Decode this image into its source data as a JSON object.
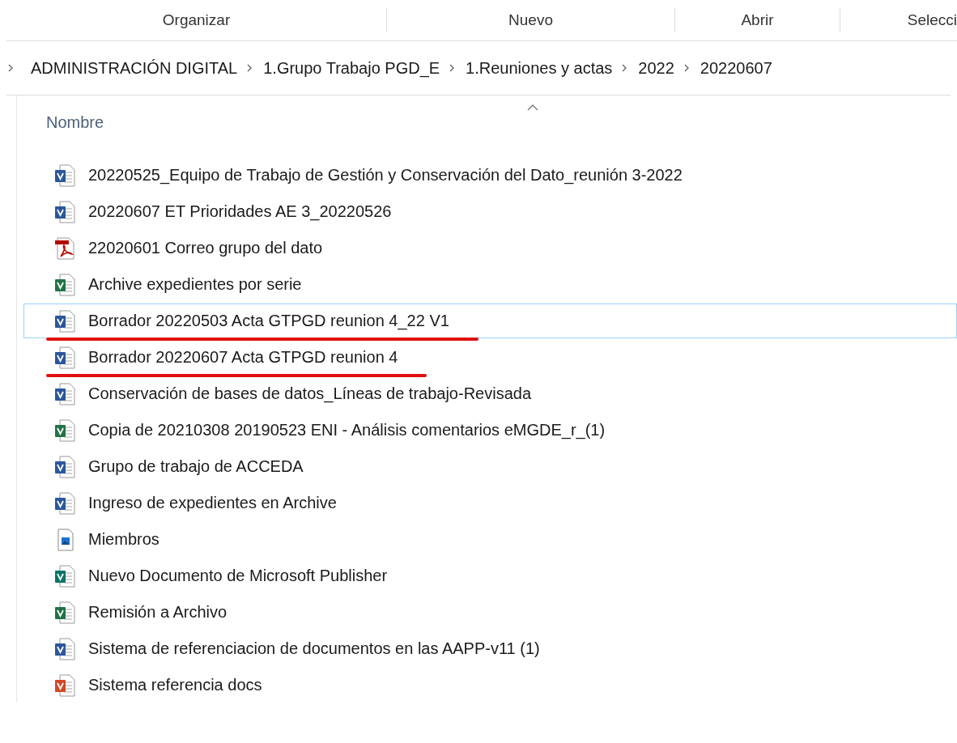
{
  "toolbar": [
    {
      "label": "Organizar"
    },
    {
      "label": "Nuevo"
    },
    {
      "label": "Abrir"
    },
    {
      "label": "Selecci"
    }
  ],
  "breadcrumb": [
    {
      "label": "ADMINISTRACIÓN DIGITAL"
    },
    {
      "label": "1.Grupo Trabajo PGD_E"
    },
    {
      "label": "1.Reuniones y actas"
    },
    {
      "label": "2022"
    },
    {
      "label": "20220607"
    }
  ],
  "column": {
    "label": "Nombre"
  },
  "files": [
    {
      "name": "20220525_Equipo de Trabajo de Gestión y Conservación del Dato_reunión 3-2022",
      "kind": "word",
      "focused": false,
      "underlined": false
    },
    {
      "name": "20220607 ET Prioridades AE 3_20220526",
      "kind": "word",
      "focused": false,
      "underlined": false
    },
    {
      "name": "22020601 Correo grupo del dato",
      "kind": "pdf",
      "focused": false,
      "underlined": false
    },
    {
      "name": "Archive expedientes por serie",
      "kind": "excel",
      "focused": false,
      "underlined": false
    },
    {
      "name": "Borrador 20220503 Acta GTPGD reunion 4_22 V1",
      "kind": "word",
      "focused": true,
      "underlined": true
    },
    {
      "name": "Borrador 20220607 Acta GTPGD reunion 4",
      "kind": "word",
      "focused": false,
      "underlined": true
    },
    {
      "name": "Conservación de bases de datos_Líneas de trabajo-Revisada",
      "kind": "word",
      "focused": false,
      "underlined": false
    },
    {
      "name": "Copia de 20210308 20190523 ENI - Análisis comentarios eMGDE_r_(1)",
      "kind": "excel",
      "focused": false,
      "underlined": false
    },
    {
      "name": "Grupo de trabajo de ACCEDA",
      "kind": "word",
      "focused": false,
      "underlined": false
    },
    {
      "name": "Ingreso de expedientes en Archive",
      "kind": "word",
      "focused": false,
      "underlined": false
    },
    {
      "name": "Miembros",
      "kind": "image",
      "focused": false,
      "underlined": false
    },
    {
      "name": "Nuevo Documento de Microsoft Publisher",
      "kind": "publisher",
      "focused": false,
      "underlined": false
    },
    {
      "name": "Remisión a Archivo",
      "kind": "excel",
      "focused": false,
      "underlined": false
    },
    {
      "name": "Sistema de referenciacion de documentos en las AAPP-v11 (1)",
      "kind": "word",
      "focused": false,
      "underlined": false
    },
    {
      "name": "Sistema referencia docs",
      "kind": "powerpoint",
      "focused": false,
      "underlined": false
    }
  ]
}
